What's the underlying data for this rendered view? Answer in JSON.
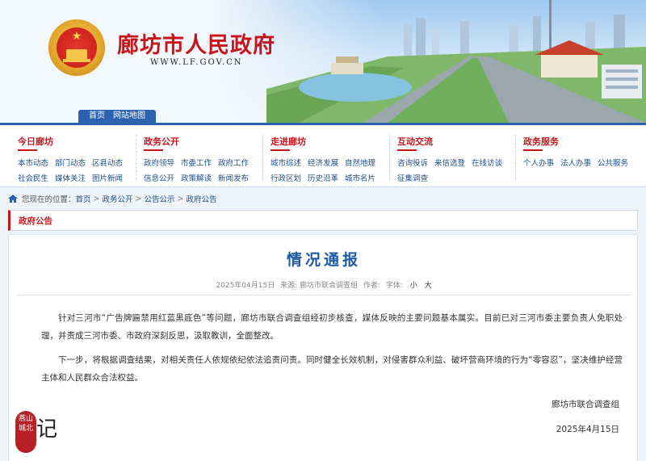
{
  "header": {
    "site_title": "廊坊市人民政府",
    "site_domain": "WWW.LF.GOV.CN",
    "quicklinks": [
      "首页",
      "网站地图"
    ]
  },
  "nav": {
    "columns": [
      {
        "title": "今日廊坊",
        "links": [
          "本市动态",
          "部门动态",
          "区县动态",
          "社会民生",
          "媒体关注",
          "图片新闻"
        ]
      },
      {
        "title": "政务公开",
        "links": [
          "政府领导",
          "市委工作",
          "政府工作",
          "信息公开",
          "政策解读",
          "新闻发布"
        ]
      },
      {
        "title": "走进廊坊",
        "links": [
          "城市综述",
          "经济发展",
          "自然地理",
          "行政区划",
          "历史沿革",
          "城市名片"
        ]
      },
      {
        "title": "互动交流",
        "links": [
          "咨询投诉",
          "来信选登",
          "在线访谈",
          "征集调查"
        ]
      },
      {
        "title": "政务服务",
        "links": [
          "个人办事",
          "法人办事",
          "公共服务"
        ]
      }
    ]
  },
  "breadcrumb": {
    "prefix": "您现在的位置：",
    "items": [
      "首页",
      "政务公开",
      "公告公示",
      "政府公告"
    ]
  },
  "section": {
    "title": "政府公告"
  },
  "article": {
    "title": "情况通报",
    "date": "2025年04月15日",
    "source": "来源: 廊坊市联合调查组",
    "author": "作者:",
    "font_label": "字体:",
    "font_small": "小",
    "font_large": "大",
    "paragraphs": [
      "针对三河市“广告牌匾禁用红蓝黑底色”等问题，廊坊市联合调查组经初步核查，媒体反映的主要问题基本属实。目前已对三河市委主要负责人免职处理，并责成三河市委、市政府深刻反思，汲取教训，全面整改。",
      "下一步，将根据调查结果，对相关责任人依规依纪依法追责问责。同时健全长效机制，对侵害群众利益、破坏营商环境的行为“零容忍”，坚决维护经营主体和人民群众合法权益。"
    ],
    "signature_org": "廊坊市联合调查组",
    "signature_date": "2025年4月15日"
  },
  "watermark": {
    "seal_text": "燕山 城北",
    "mark": "记"
  },
  "colors": {
    "brand_red": "#c8141b",
    "brand_blue": "#2b63b0",
    "title_blue": "#1f5aa6"
  }
}
